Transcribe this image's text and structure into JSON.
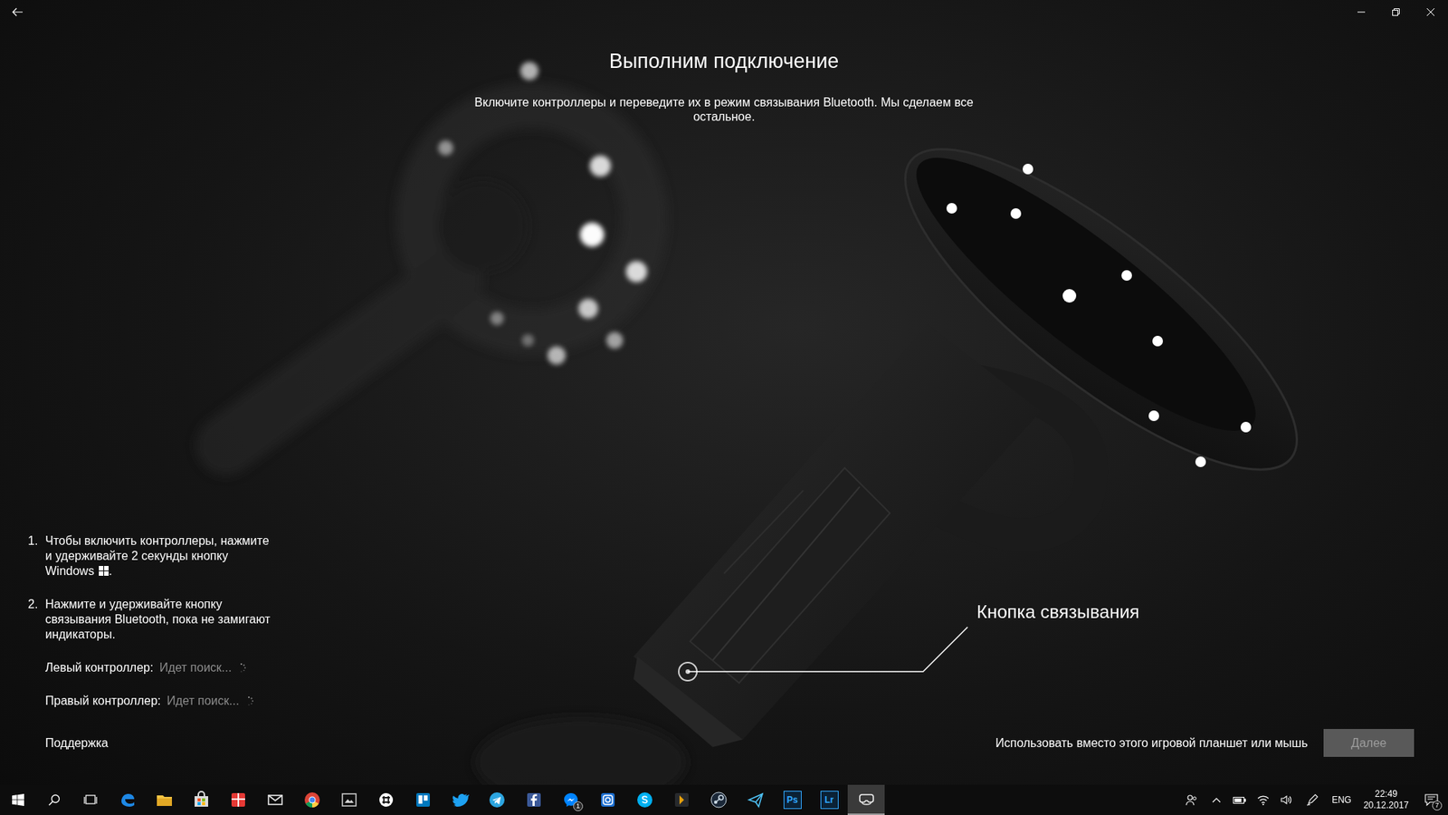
{
  "header": {
    "title": "Выполним подключение",
    "subtitle": "Включите контроллеры и переведите их в режим связывания Bluetooth. Мы сделаем все остальное."
  },
  "callout": "Кнопка связывания",
  "steps": [
    {
      "number": "1.",
      "text": "Чтобы включить контроллеры, нажмите и удерживайте 2 секунды кнопку Windows",
      "windows_icon": true,
      "suffix": "."
    },
    {
      "number": "2.",
      "text": "Нажмите и удерживайте кнопку связывания Bluetooth, пока не замигают индикаторы.",
      "windows_icon": false,
      "suffix": ""
    }
  ],
  "controllers": [
    {
      "label": "Левый контроллер:",
      "status": "Идет поиск...",
      "searching": true
    },
    {
      "label": "Правый контроллер:",
      "status": "Идет поиск...",
      "searching": true
    }
  ],
  "support_link": "Поддержка",
  "alternative_link": "Использовать вместо этого игровой планшет или мышь",
  "next_button": {
    "label": "Далее",
    "disabled": true
  },
  "taskbar": {
    "apps": [
      {
        "text": "",
        "badge": "",
        "active": false
      },
      {
        "text": "",
        "badge": "",
        "active": false
      },
      {
        "text": "",
        "badge": "",
        "active": false
      },
      {
        "text": "",
        "badge": "",
        "active": false
      },
      {
        "text": "",
        "badge": "",
        "active": false
      },
      {
        "text": "",
        "badge": "",
        "active": false
      },
      {
        "text": "",
        "badge": "",
        "active": false
      },
      {
        "text": "",
        "badge": "",
        "active": false
      },
      {
        "text": "",
        "badge": "",
        "active": false
      },
      {
        "text": "",
        "badge": "",
        "active": false
      },
      {
        "text": "",
        "badge": "",
        "active": false
      },
      {
        "text": "",
        "badge": "",
        "active": false
      },
      {
        "text": "",
        "badge": "1",
        "active": false
      },
      {
        "text": "",
        "badge": "",
        "active": false
      },
      {
        "text": "",
        "badge": "",
        "active": false
      },
      {
        "text": "",
        "badge": "",
        "active": false
      },
      {
        "text": "",
        "badge": "",
        "active": false
      },
      {
        "text": "",
        "badge": "",
        "active": false
      },
      {
        "text": "Ps",
        "badge": "",
        "active": false
      },
      {
        "text": "Lr",
        "badge": "",
        "active": false
      },
      {
        "text": "",
        "badge": "",
        "active": true
      }
    ],
    "tray": {
      "language": "ENG",
      "time": "22:49",
      "date": "20.12.2017",
      "notifications": "7"
    }
  }
}
